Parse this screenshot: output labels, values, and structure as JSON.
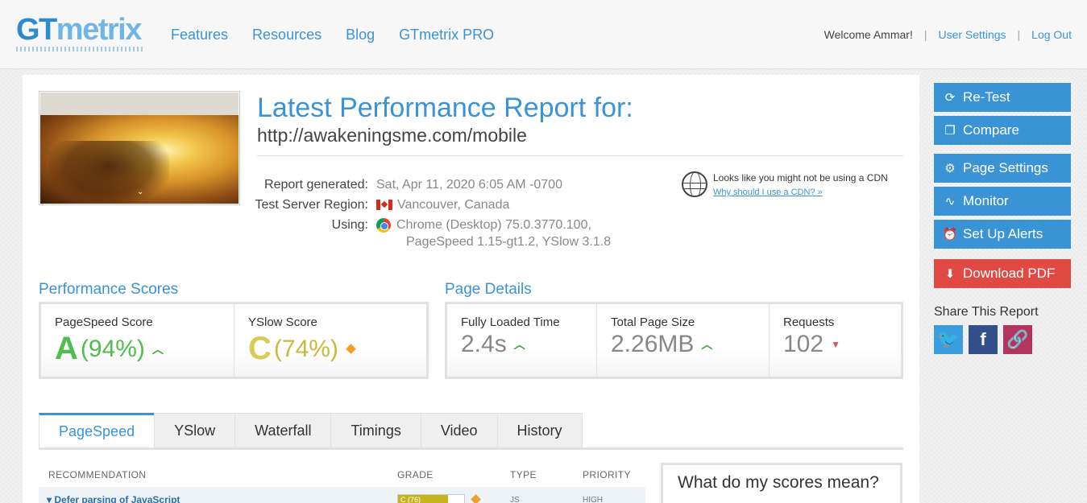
{
  "header": {
    "logo_gt": "GT",
    "logo_metrix": "metrix",
    "nav": [
      "Features",
      "Resources",
      "Blog",
      "GTmetrix PRO"
    ],
    "welcome": "Welcome Ammar!",
    "sep": "|",
    "user_settings": "User Settings",
    "log_out": "Log Out"
  },
  "report": {
    "title": "Latest Performance Report for:",
    "url": "http://awakeningsme.com/mobile",
    "generated_label": "Report generated:",
    "generated_value": "Sat, Apr 11, 2020 6:05 AM -0700",
    "region_label": "Test Server Region:",
    "region_value": "Vancouver, Canada",
    "using_label": "Using:",
    "using_value": "Chrome (Desktop) 75.0.3770.100,",
    "using_value2": "PageSpeed 1.15-gt1.2, YSlow 3.1.8",
    "cdn_text": "Looks like you might not be using a CDN",
    "cdn_link": "Why should I use a CDN? »",
    "thumb_chevron": "⌄"
  },
  "performance": {
    "heading": "Performance Scores",
    "pagespeed_label": "PageSpeed Score",
    "pagespeed_grade": "A",
    "pagespeed_pct": "(94%)",
    "yslow_label": "YSlow Score",
    "yslow_grade": "C",
    "yslow_pct": "(74%)"
  },
  "details": {
    "heading": "Page Details",
    "loaded_label": "Fully Loaded Time",
    "loaded_value": "2.4s",
    "size_label": "Total Page Size",
    "size_value": "2.26MB",
    "requests_label": "Requests",
    "requests_value": "102"
  },
  "tabs": [
    "PageSpeed",
    "YSlow",
    "Waterfall",
    "Timings",
    "Video",
    "History"
  ],
  "table": {
    "headers": [
      "RECOMMENDATION",
      "GRADE",
      "TYPE",
      "PRIORITY"
    ],
    "rows": [
      {
        "name": "Defer parsing of JavaScript",
        "grade": "C (76)",
        "grade_pct": 76,
        "type": "JS",
        "priority": "HIGH"
      }
    ]
  },
  "scores_question": "What do my scores mean?",
  "sidebar": {
    "buttons": [
      "Re-Test",
      "Compare",
      "Page Settings",
      "Monitor",
      "Set Up Alerts",
      "Download PDF"
    ],
    "share_title": "Share This Report"
  },
  "colors": {
    "brand_blue": "#3a93d5",
    "pdf_red": "#e04a43",
    "grade_a": "#4fbe4a",
    "grade_c": "#d8cc55"
  }
}
